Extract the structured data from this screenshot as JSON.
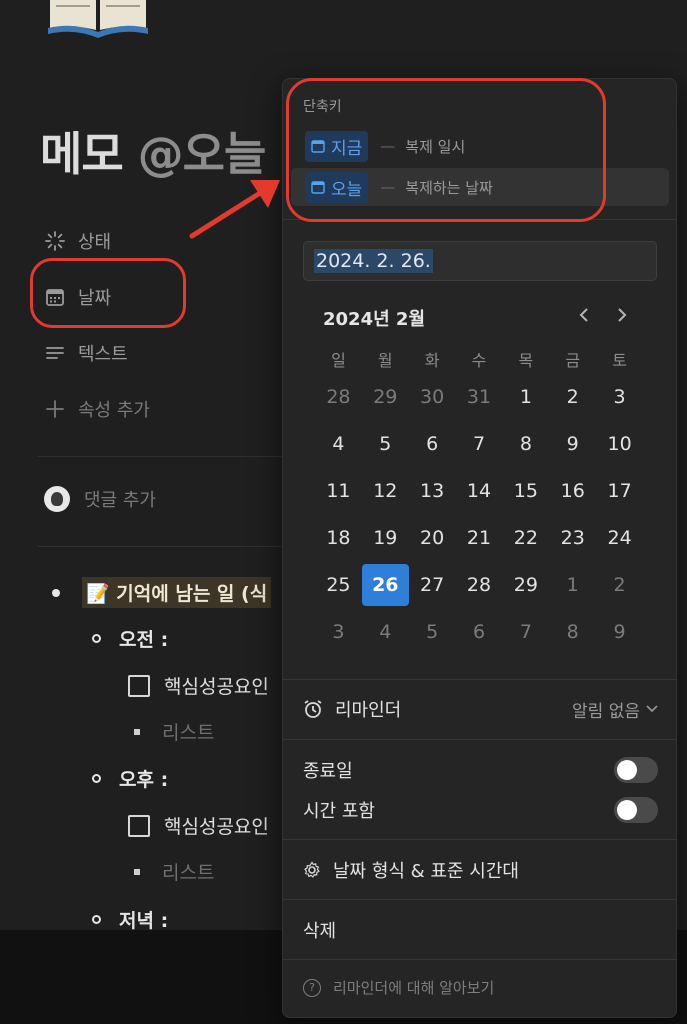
{
  "page": {
    "title": "메모",
    "title_mention": "@오늘",
    "properties": [
      {
        "label": "상태",
        "icon": "status-spinner-icon"
      },
      {
        "label": "날짜",
        "icon": "calendar-icon"
      },
      {
        "label": "텍스트",
        "icon": "text-lines-icon"
      },
      {
        "label": "속성 추가",
        "icon": "plus-icon"
      }
    ],
    "comment_placeholder": "댓글 추가",
    "content": {
      "heading_bullet": "기억에 남는 일 (식",
      "morning": "오전 :",
      "afternoon": "오후 :",
      "evening": "저녁 :",
      "todo_text": "핵심성공요인",
      "list_placeholder": "리스트"
    }
  },
  "popup": {
    "shortcut_title": "단축키",
    "shortcuts": [
      {
        "chip": "지금",
        "desc": "복제 일시"
      },
      {
        "chip": "오늘",
        "desc": "복제하는 날짜"
      }
    ],
    "date_value": "2024. 2. 26.",
    "month_label": "2024년 2월",
    "weekdays": [
      "일",
      "월",
      "화",
      "수",
      "목",
      "금",
      "토"
    ],
    "weeks": [
      [
        "28",
        "29",
        "30",
        "31",
        "1",
        "2",
        "3"
      ],
      [
        "4",
        "5",
        "6",
        "7",
        "8",
        "9",
        "10"
      ],
      [
        "11",
        "12",
        "13",
        "14",
        "15",
        "16",
        "17"
      ],
      [
        "18",
        "19",
        "20",
        "21",
        "22",
        "23",
        "24"
      ],
      [
        "25",
        "26",
        "27",
        "28",
        "29",
        "1",
        "2"
      ],
      [
        "3",
        "4",
        "5",
        "6",
        "7",
        "8",
        "9"
      ]
    ],
    "selected_day": "26",
    "reminder_label": "리마인더",
    "reminder_value": "알림 없음",
    "end_date_label": "종료일",
    "include_time_label": "시간 포함",
    "format_label": "날짜 형식 & 표준 시간대",
    "delete_label": "삭제",
    "help_label": "리마인더에 대해 알아보기"
  },
  "colors": {
    "accent": "#2f7fd8",
    "chip_text": "#5aa2f0",
    "annotation": "#e23b2e"
  }
}
